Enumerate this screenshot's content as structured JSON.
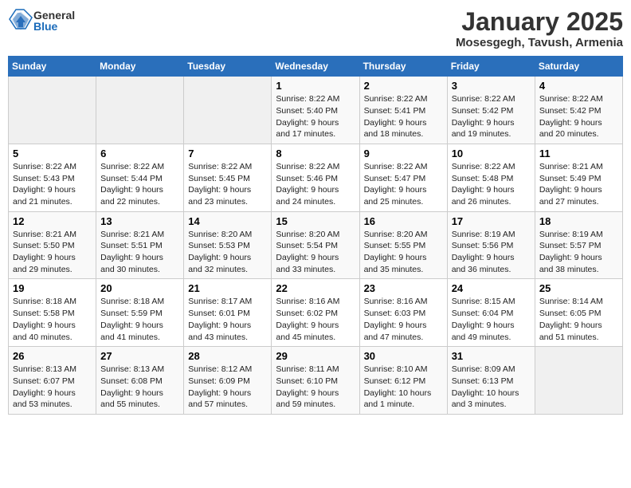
{
  "logo": {
    "general": "General",
    "blue": "Blue"
  },
  "title": "January 2025",
  "location": "Mosesgegh, Tavush, Armenia",
  "weekdays": [
    "Sunday",
    "Monday",
    "Tuesday",
    "Wednesday",
    "Thursday",
    "Friday",
    "Saturday"
  ],
  "weeks": [
    [
      {
        "day": "",
        "sunrise": "",
        "sunset": "",
        "daylight": ""
      },
      {
        "day": "",
        "sunrise": "",
        "sunset": "",
        "daylight": ""
      },
      {
        "day": "",
        "sunrise": "",
        "sunset": "",
        "daylight": ""
      },
      {
        "day": "1",
        "sunrise": "Sunrise: 8:22 AM",
        "sunset": "Sunset: 5:40 PM",
        "daylight": "Daylight: 9 hours and 17 minutes."
      },
      {
        "day": "2",
        "sunrise": "Sunrise: 8:22 AM",
        "sunset": "Sunset: 5:41 PM",
        "daylight": "Daylight: 9 hours and 18 minutes."
      },
      {
        "day": "3",
        "sunrise": "Sunrise: 8:22 AM",
        "sunset": "Sunset: 5:42 PM",
        "daylight": "Daylight: 9 hours and 19 minutes."
      },
      {
        "day": "4",
        "sunrise": "Sunrise: 8:22 AM",
        "sunset": "Sunset: 5:42 PM",
        "daylight": "Daylight: 9 hours and 20 minutes."
      }
    ],
    [
      {
        "day": "5",
        "sunrise": "Sunrise: 8:22 AM",
        "sunset": "Sunset: 5:43 PM",
        "daylight": "Daylight: 9 hours and 21 minutes."
      },
      {
        "day": "6",
        "sunrise": "Sunrise: 8:22 AM",
        "sunset": "Sunset: 5:44 PM",
        "daylight": "Daylight: 9 hours and 22 minutes."
      },
      {
        "day": "7",
        "sunrise": "Sunrise: 8:22 AM",
        "sunset": "Sunset: 5:45 PM",
        "daylight": "Daylight: 9 hours and 23 minutes."
      },
      {
        "day": "8",
        "sunrise": "Sunrise: 8:22 AM",
        "sunset": "Sunset: 5:46 PM",
        "daylight": "Daylight: 9 hours and 24 minutes."
      },
      {
        "day": "9",
        "sunrise": "Sunrise: 8:22 AM",
        "sunset": "Sunset: 5:47 PM",
        "daylight": "Daylight: 9 hours and 25 minutes."
      },
      {
        "day": "10",
        "sunrise": "Sunrise: 8:22 AM",
        "sunset": "Sunset: 5:48 PM",
        "daylight": "Daylight: 9 hours and 26 minutes."
      },
      {
        "day": "11",
        "sunrise": "Sunrise: 8:21 AM",
        "sunset": "Sunset: 5:49 PM",
        "daylight": "Daylight: 9 hours and 27 minutes."
      }
    ],
    [
      {
        "day": "12",
        "sunrise": "Sunrise: 8:21 AM",
        "sunset": "Sunset: 5:50 PM",
        "daylight": "Daylight: 9 hours and 29 minutes."
      },
      {
        "day": "13",
        "sunrise": "Sunrise: 8:21 AM",
        "sunset": "Sunset: 5:51 PM",
        "daylight": "Daylight: 9 hours and 30 minutes."
      },
      {
        "day": "14",
        "sunrise": "Sunrise: 8:20 AM",
        "sunset": "Sunset: 5:53 PM",
        "daylight": "Daylight: 9 hours and 32 minutes."
      },
      {
        "day": "15",
        "sunrise": "Sunrise: 8:20 AM",
        "sunset": "Sunset: 5:54 PM",
        "daylight": "Daylight: 9 hours and 33 minutes."
      },
      {
        "day": "16",
        "sunrise": "Sunrise: 8:20 AM",
        "sunset": "Sunset: 5:55 PM",
        "daylight": "Daylight: 9 hours and 35 minutes."
      },
      {
        "day": "17",
        "sunrise": "Sunrise: 8:19 AM",
        "sunset": "Sunset: 5:56 PM",
        "daylight": "Daylight: 9 hours and 36 minutes."
      },
      {
        "day": "18",
        "sunrise": "Sunrise: 8:19 AM",
        "sunset": "Sunset: 5:57 PM",
        "daylight": "Daylight: 9 hours and 38 minutes."
      }
    ],
    [
      {
        "day": "19",
        "sunrise": "Sunrise: 8:18 AM",
        "sunset": "Sunset: 5:58 PM",
        "daylight": "Daylight: 9 hours and 40 minutes."
      },
      {
        "day": "20",
        "sunrise": "Sunrise: 8:18 AM",
        "sunset": "Sunset: 5:59 PM",
        "daylight": "Daylight: 9 hours and 41 minutes."
      },
      {
        "day": "21",
        "sunrise": "Sunrise: 8:17 AM",
        "sunset": "Sunset: 6:01 PM",
        "daylight": "Daylight: 9 hours and 43 minutes."
      },
      {
        "day": "22",
        "sunrise": "Sunrise: 8:16 AM",
        "sunset": "Sunset: 6:02 PM",
        "daylight": "Daylight: 9 hours and 45 minutes."
      },
      {
        "day": "23",
        "sunrise": "Sunrise: 8:16 AM",
        "sunset": "Sunset: 6:03 PM",
        "daylight": "Daylight: 9 hours and 47 minutes."
      },
      {
        "day": "24",
        "sunrise": "Sunrise: 8:15 AM",
        "sunset": "Sunset: 6:04 PM",
        "daylight": "Daylight: 9 hours and 49 minutes."
      },
      {
        "day": "25",
        "sunrise": "Sunrise: 8:14 AM",
        "sunset": "Sunset: 6:05 PM",
        "daylight": "Daylight: 9 hours and 51 minutes."
      }
    ],
    [
      {
        "day": "26",
        "sunrise": "Sunrise: 8:13 AM",
        "sunset": "Sunset: 6:07 PM",
        "daylight": "Daylight: 9 hours and 53 minutes."
      },
      {
        "day": "27",
        "sunrise": "Sunrise: 8:13 AM",
        "sunset": "Sunset: 6:08 PM",
        "daylight": "Daylight: 9 hours and 55 minutes."
      },
      {
        "day": "28",
        "sunrise": "Sunrise: 8:12 AM",
        "sunset": "Sunset: 6:09 PM",
        "daylight": "Daylight: 9 hours and 57 minutes."
      },
      {
        "day": "29",
        "sunrise": "Sunrise: 8:11 AM",
        "sunset": "Sunset: 6:10 PM",
        "daylight": "Daylight: 9 hours and 59 minutes."
      },
      {
        "day": "30",
        "sunrise": "Sunrise: 8:10 AM",
        "sunset": "Sunset: 6:12 PM",
        "daylight": "Daylight: 10 hours and 1 minute."
      },
      {
        "day": "31",
        "sunrise": "Sunrise: 8:09 AM",
        "sunset": "Sunset: 6:13 PM",
        "daylight": "Daylight: 10 hours and 3 minutes."
      },
      {
        "day": "",
        "sunrise": "",
        "sunset": "",
        "daylight": ""
      }
    ]
  ]
}
